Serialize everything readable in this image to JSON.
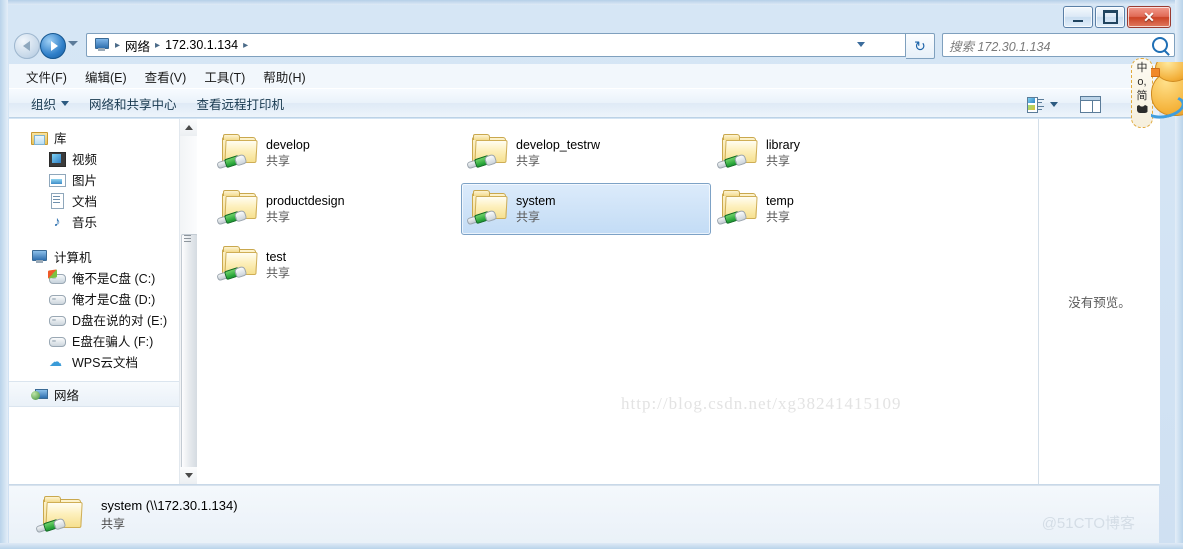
{
  "window": {
    "title": "",
    "controls": {
      "minimize": "–",
      "maximize": "□",
      "close": "✕"
    }
  },
  "address_bar": {
    "back_tooltip": "后退",
    "forward_tooltip": "前进",
    "breadcrumbs": [
      "网络",
      "172.30.1.134"
    ],
    "separator": "▸",
    "refresh": "↻"
  },
  "search": {
    "placeholder": "搜索 172.30.1.134"
  },
  "menu": {
    "items": [
      "文件(F)",
      "编辑(E)",
      "查看(V)",
      "工具(T)",
      "帮助(H)"
    ]
  },
  "command_bar": {
    "organize": "组织",
    "network_center": "网络和共享中心",
    "remote_printers": "查看远程打印机"
  },
  "nav_pane": {
    "groups": [
      {
        "label": "库",
        "icon": "library-icon",
        "children": [
          {
            "label": "视频",
            "icon": "video-icon"
          },
          {
            "label": "图片",
            "icon": "picture-icon"
          },
          {
            "label": "文档",
            "icon": "document-icon"
          },
          {
            "label": "音乐",
            "icon": "music-icon"
          }
        ]
      },
      {
        "label": "计算机",
        "icon": "computer-icon",
        "children": [
          {
            "label": "俺不是C盘 (C:)",
            "icon": "system-drive-icon"
          },
          {
            "label": "俺才是C盘 (D:)",
            "icon": "drive-icon"
          },
          {
            "label": "D盘在说的对 (E:)",
            "icon": "drive-icon"
          },
          {
            "label": "E盘在骗人 (F:)",
            "icon": "drive-icon"
          },
          {
            "label": "WPS云文档",
            "icon": "cloud-icon"
          }
        ]
      },
      {
        "label": "网络",
        "icon": "network-icon",
        "children": []
      }
    ]
  },
  "files": [
    {
      "name": "develop",
      "sub": "共享",
      "selected": false
    },
    {
      "name": "develop_testrw",
      "sub": "共享",
      "selected": false
    },
    {
      "name": "library",
      "sub": "共享",
      "selected": false
    },
    {
      "name": "productdesign",
      "sub": "共享",
      "selected": false
    },
    {
      "name": "system",
      "sub": "共享",
      "selected": true
    },
    {
      "name": "temp",
      "sub": "共享",
      "selected": false
    },
    {
      "name": "test",
      "sub": "共享",
      "selected": false
    }
  ],
  "watermark": "http://blog.csdn.net/xg38241415109",
  "preview_pane": {
    "text": "没有预览。"
  },
  "status_bar": {
    "title": "system (\\\\172.30.1.134)",
    "subtitle": "共享"
  },
  "blog_mark": "@51CTO博客",
  "ime": {
    "mode": "中",
    "punct": "o,",
    "script": "简",
    "skin": "shirt-icon"
  },
  "colors": {
    "accent": "#3f9ede",
    "selection_fill": "#c3dcf5",
    "selection_border": "#7da2c6",
    "frame": "#b9d3ea",
    "folder": "#f4dd92",
    "share_green": "#189a2e"
  }
}
